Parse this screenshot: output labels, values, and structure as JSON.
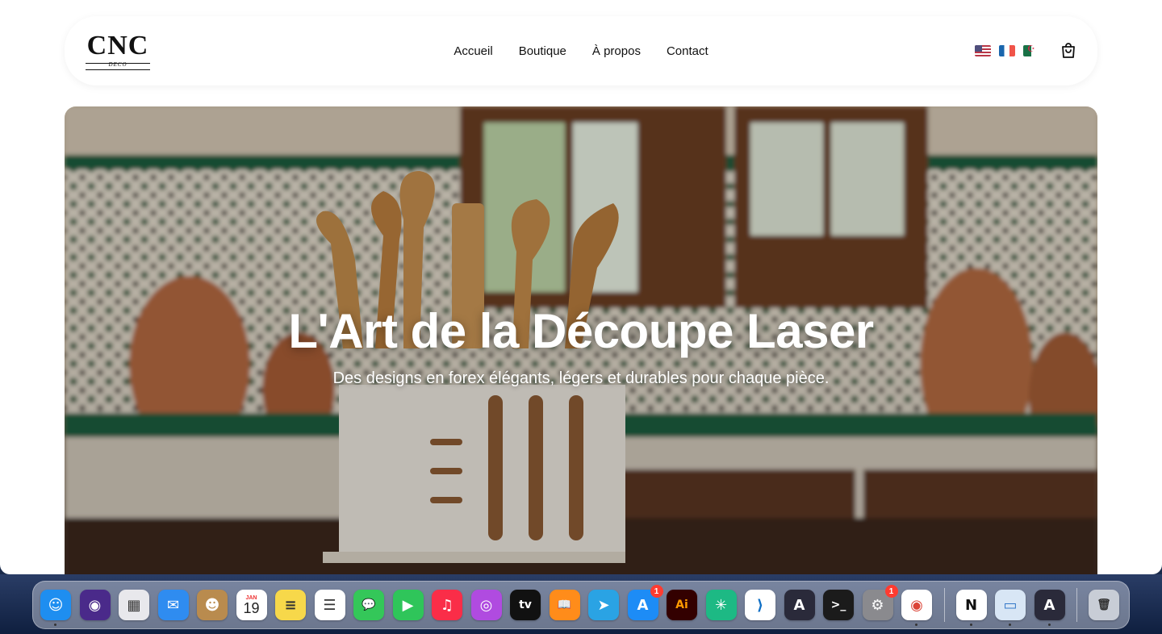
{
  "brand": {
    "logo_text": "CNC",
    "logo_sub": "DECO"
  },
  "nav": {
    "items": [
      "Accueil",
      "Boutique",
      "À propos",
      "Contact"
    ]
  },
  "languages": [
    "us-flag-icon",
    "fr-flag-icon",
    "dz-flag-icon"
  ],
  "cart": {
    "icon": "shopping-bag-icon"
  },
  "hero": {
    "title": "L'Art de la Découpe Laser",
    "subtitle": "Des designs en forex élégants, légers et durables pour chaque pièce."
  },
  "dock": {
    "apps": [
      {
        "name": "Finder",
        "icon": "finder-icon",
        "color": "#1e8ef0",
        "glyph": "☺",
        "running": true
      },
      {
        "name": "Siri",
        "icon": "siri-icon",
        "color": "#4a2a8a",
        "glyph": "◉"
      },
      {
        "name": "Launchpad",
        "icon": "launchpad-icon",
        "color": "#e8e8ec",
        "glyph": "▦"
      },
      {
        "name": "Mail",
        "icon": "mail-icon",
        "color": "#2f8cf0",
        "glyph": "✉"
      },
      {
        "name": "Contacts",
        "icon": "contacts-icon",
        "color": "#b98b4e",
        "glyph": "☻"
      },
      {
        "name": "Calendar",
        "icon": "calendar-icon",
        "color": "#ffffff",
        "glyph": "19",
        "label": "JAN"
      },
      {
        "name": "Notes",
        "icon": "notes-icon",
        "color": "#f7d84a",
        "glyph": "≡"
      },
      {
        "name": "Reminders",
        "icon": "reminders-icon",
        "color": "#ffffff",
        "glyph": "☰"
      },
      {
        "name": "Messages",
        "icon": "messages-icon",
        "color": "#34c759",
        "glyph": "💬"
      },
      {
        "name": "FaceTime",
        "icon": "facetime-icon",
        "color": "#2fc55a",
        "glyph": "▶"
      },
      {
        "name": "Music",
        "icon": "music-icon",
        "color": "#fa2d48",
        "glyph": "♫"
      },
      {
        "name": "Podcasts",
        "icon": "podcasts-icon",
        "color": "#b04be0",
        "glyph": "◎"
      },
      {
        "name": "TV",
        "icon": "apple-tv-icon",
        "color": "#111111",
        "glyph": "tv"
      },
      {
        "name": "Books",
        "icon": "books-icon",
        "color": "#ff8c1a",
        "glyph": "📖"
      },
      {
        "name": "Telegram",
        "icon": "telegram-icon",
        "color": "#2aa3e4",
        "glyph": "➤"
      },
      {
        "name": "App Store",
        "icon": "app-store-icon",
        "color": "#1d8cf6",
        "glyph": "A",
        "badge": "1"
      },
      {
        "name": "Illustrator",
        "icon": "illustrator-icon",
        "color": "#330000",
        "glyph": "Ai",
        "glyph_color": "#ff9a00"
      },
      {
        "name": "Perplexity",
        "icon": "perplexity-icon",
        "color": "#1db984",
        "glyph": "✳"
      },
      {
        "name": "VS Code",
        "icon": "vscode-icon",
        "color": "#ffffff",
        "glyph": "⟩",
        "glyph_color": "#0f6fc5"
      },
      {
        "name": "Arc",
        "icon": "arc-icon",
        "color": "#2a2a3a",
        "glyph": "A"
      },
      {
        "name": "Terminal",
        "icon": "terminal-icon",
        "color": "#1b1b1b",
        "glyph": ">_"
      },
      {
        "name": "System Settings",
        "icon": "settings-icon",
        "color": "#8a8a8e",
        "glyph": "⚙",
        "badge": "1"
      },
      {
        "name": "Chrome",
        "icon": "chrome-icon",
        "color": "#ffffff",
        "glyph": "◉",
        "glyph_color": "#db4437",
        "running": true
      }
    ],
    "recent": [
      {
        "name": "Notion",
        "icon": "notion-icon",
        "color": "#ffffff",
        "glyph": "N",
        "glyph_color": "#111",
        "running": true
      },
      {
        "name": "Preview",
        "icon": "preview-icon",
        "color": "#d8e6f5",
        "glyph": "▭",
        "glyph_color": "#3478c8",
        "running": true
      },
      {
        "name": "Arc",
        "icon": "arc-icon",
        "color": "#2a2a3a",
        "glyph": "A",
        "running": true
      }
    ],
    "trash": {
      "name": "Trash",
      "icon": "trash-icon",
      "color": "#c8cdd6",
      "glyph": "🗑"
    }
  }
}
